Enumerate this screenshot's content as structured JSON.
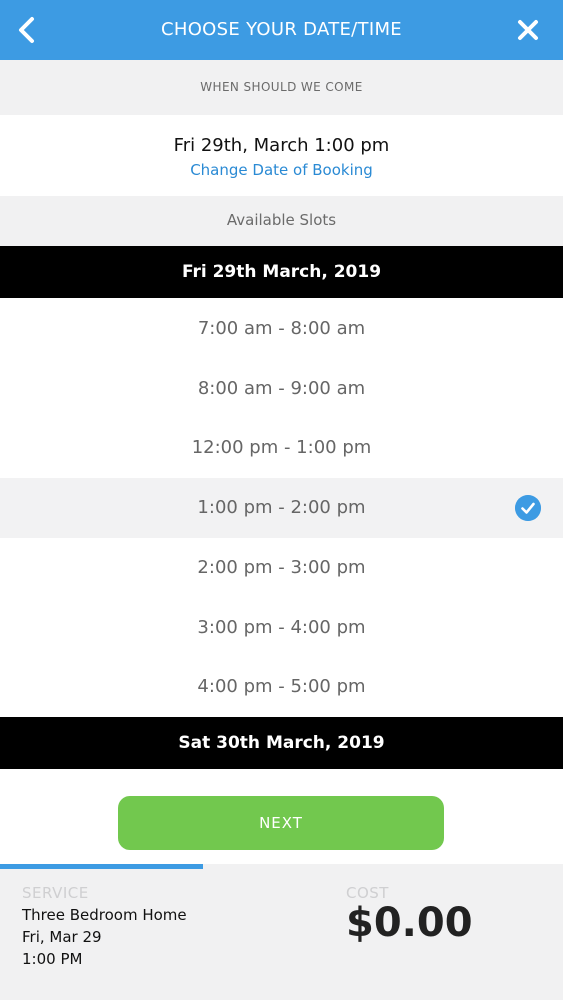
{
  "header": {
    "title": "CHOOSE YOUR DATE/TIME",
    "background": "#3d9be3"
  },
  "when": {
    "label": "WHEN SHOULD WE COME",
    "selected_datetime": "Fri 29th, March 1:00 pm",
    "change_link": "Change Date of Booking"
  },
  "slots": {
    "label": "Available Slots",
    "days": [
      {
        "date": "Fri 29th March, 2019",
        "times": [
          {
            "label": "7:00 am - 8:00 am",
            "selected": false
          },
          {
            "label": "8:00 am - 9:00 am",
            "selected": false
          },
          {
            "label": "12:00 pm - 1:00 pm",
            "selected": false
          },
          {
            "label": "1:00 pm - 2:00 pm",
            "selected": true
          },
          {
            "label": "2:00 pm - 3:00 pm",
            "selected": false
          },
          {
            "label": "3:00 pm - 4:00 pm",
            "selected": false
          },
          {
            "label": "4:00 pm - 5:00 pm",
            "selected": false
          }
        ]
      },
      {
        "date": "Sat 30th March, 2019",
        "times": []
      }
    ]
  },
  "next_button": {
    "label": "NEXT",
    "color": "#72c84e"
  },
  "progress": {
    "fraction": 0.36
  },
  "summary": {
    "service_label": "SERVICE",
    "service_name": "Three Bedroom Home",
    "service_date": "Fri, Mar 29",
    "service_time": "1:00 PM",
    "cost_label": "COST",
    "cost_value": "$0.00"
  },
  "icons": {
    "back": "chevron-left-icon",
    "close": "close-icon",
    "selected": "check-circle-icon"
  }
}
